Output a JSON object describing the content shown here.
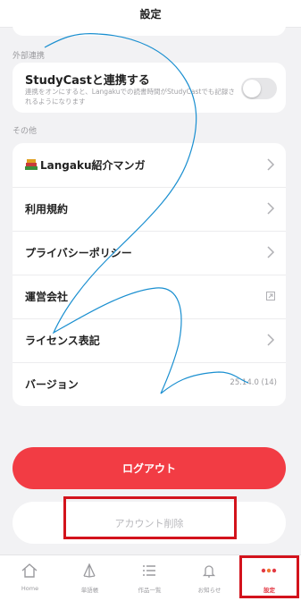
{
  "header": {
    "title": "設定"
  },
  "sections": {
    "external_link_label": "外部連携",
    "other_label": "その他"
  },
  "studycast": {
    "title": "StudyCastと連携する",
    "description": "連携をオンにすると、Langakuでの読書時間がStudyCastでも記録されるようになります",
    "toggle_on": false
  },
  "other_items": [
    {
      "label": "Langaku紹介マンガ",
      "trailing": "chevron"
    },
    {
      "label": "利用規約",
      "trailing": "chevron"
    },
    {
      "label": "プライバシーポリシー",
      "trailing": "chevron"
    },
    {
      "label": "運営会社",
      "trailing": "external-link"
    },
    {
      "label": "ライセンス表記",
      "trailing": "chevron"
    },
    {
      "label": "バージョン",
      "value": "25.14.0 (14)"
    }
  ],
  "buttons": {
    "logout": "ログアウト",
    "delete_account": "アカウント削除"
  },
  "tabbar": {
    "tabs": [
      {
        "label": "Home",
        "icon": "home-icon",
        "active": false
      },
      {
        "label": "単語帳",
        "icon": "vocabulary-book-icon",
        "active": false
      },
      {
        "label": "作品一覧",
        "icon": "list-icon",
        "active": false
      },
      {
        "label": "お知らせ",
        "icon": "bell-icon",
        "active": false
      },
      {
        "label": "設定",
        "icon": "more-dots-icon",
        "active": true
      }
    ]
  },
  "colors": {
    "accent": "#f23c44",
    "highlight_box": "#d3131c",
    "scribble": "#1a8fd0",
    "background": "#f2f2f4"
  }
}
